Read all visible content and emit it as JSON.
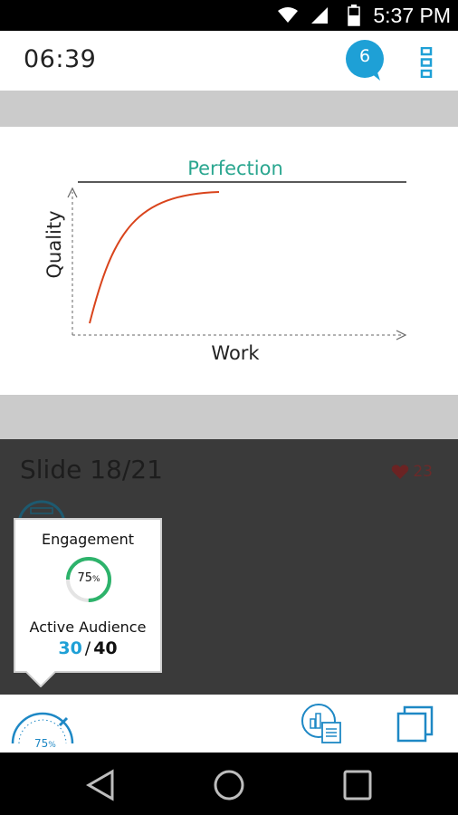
{
  "status_bar": {
    "time": "5:37 PM"
  },
  "header": {
    "timer": "06:39",
    "chat_count": "6"
  },
  "slide": {
    "title": "Perfection",
    "y_axis_label": "Quality",
    "x_axis_label": "Work"
  },
  "panel": {
    "slide_label": "Slide 18/21",
    "likes": "23"
  },
  "engagement_popover": {
    "title": "Engagement",
    "percent": "75",
    "percent_unit": "%",
    "audience_title": "Active Audience",
    "active": "30",
    "separator": "/",
    "total": "40"
  },
  "bottom_bar": {
    "gauge_percent": "75",
    "gauge_unit": "%"
  },
  "colors": {
    "accent_teal": "#2aa68f",
    "accent_blue": "#1ea0d6",
    "curve": "#d9441c",
    "ring_green": "#2db36b"
  }
}
